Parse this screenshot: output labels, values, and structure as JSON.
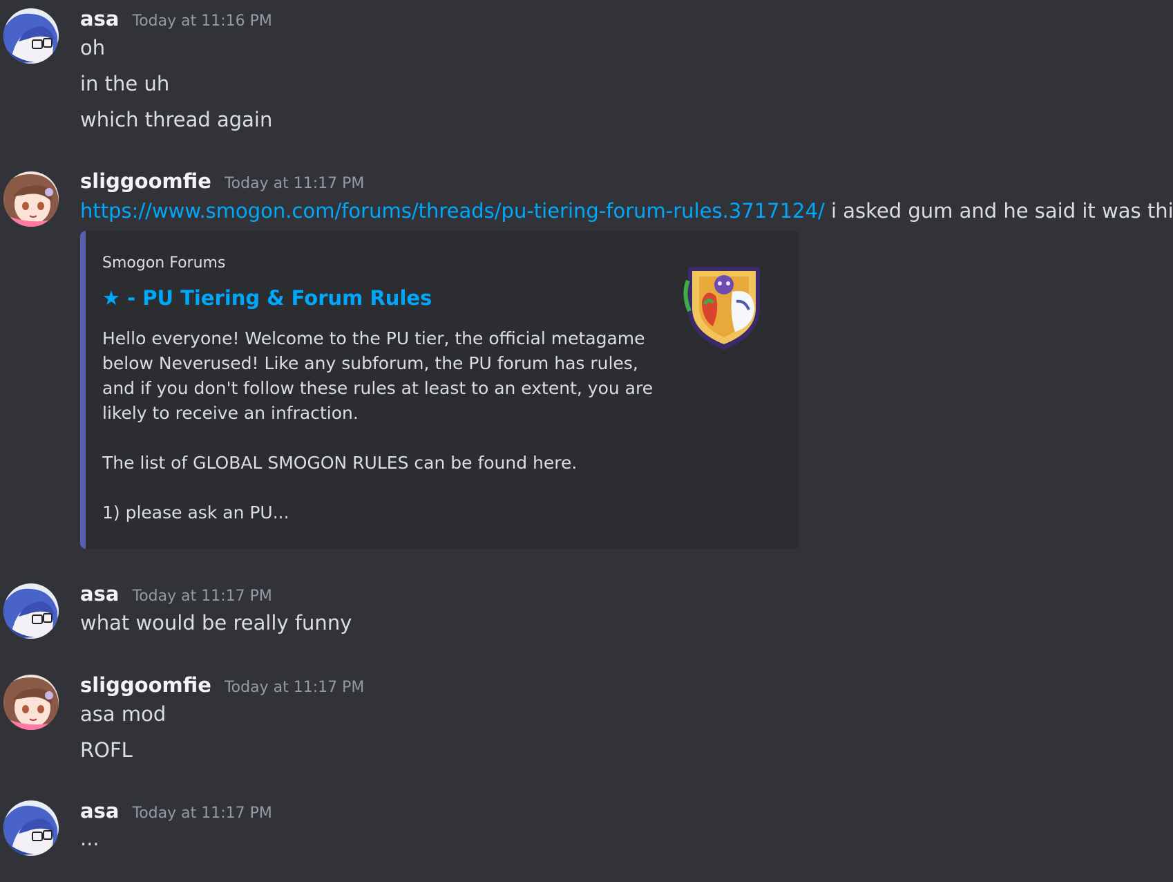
{
  "messages": [
    {
      "username": "asa",
      "timestamp": "Today at 11:16 PM",
      "lines": [
        "oh",
        "in the uh",
        "which thread again"
      ]
    },
    {
      "username": "sliggoomfie",
      "timestamp": "Today at 11:17 PM",
      "link": "https://www.smogon.com/forums/threads/pu-tiering-forum-rules.3717124/",
      "link_trailing_text": "i asked gum and he said it was this one",
      "embed": {
        "provider": "Smogon Forums",
        "title": "★ - PU Tiering & Forum Rules",
        "description": "Hello everyone! Welcome to the PU tier, the official metagame below Neverused! Like any subforum, the PU forum has rules, and if you don't follow these rules at least to an extent, you are likely to receive an infraction.\n\nThe list of GLOBAL SMOGON RULES can be found here.\n\n1) please ask an PU..."
      }
    },
    {
      "username": "asa",
      "timestamp": "Today at 11:17 PM",
      "lines": [
        "what would be really funny"
      ]
    },
    {
      "username": "sliggoomfie",
      "timestamp": "Today at 11:17 PM",
      "lines": [
        "asa mod",
        "ROFL"
      ]
    },
    {
      "username": "asa",
      "timestamp": "Today at 11:17 PM",
      "lines": [
        "..."
      ]
    }
  ],
  "colors": {
    "background": "#313338",
    "link": "#00a8fc",
    "embed_bg": "#2b2d31",
    "embed_border": "#5a5fb0",
    "username": "#f2f3f5",
    "timestamp": "#949ba4"
  },
  "icons": {
    "asa_avatar": "anime-girl-blue-hair-avatar-icon",
    "sliggoomfie_avatar": "anime-girl-brown-hair-avatar-icon",
    "embed_thumbnail": "smogon-pu-shield-logo-icon"
  }
}
